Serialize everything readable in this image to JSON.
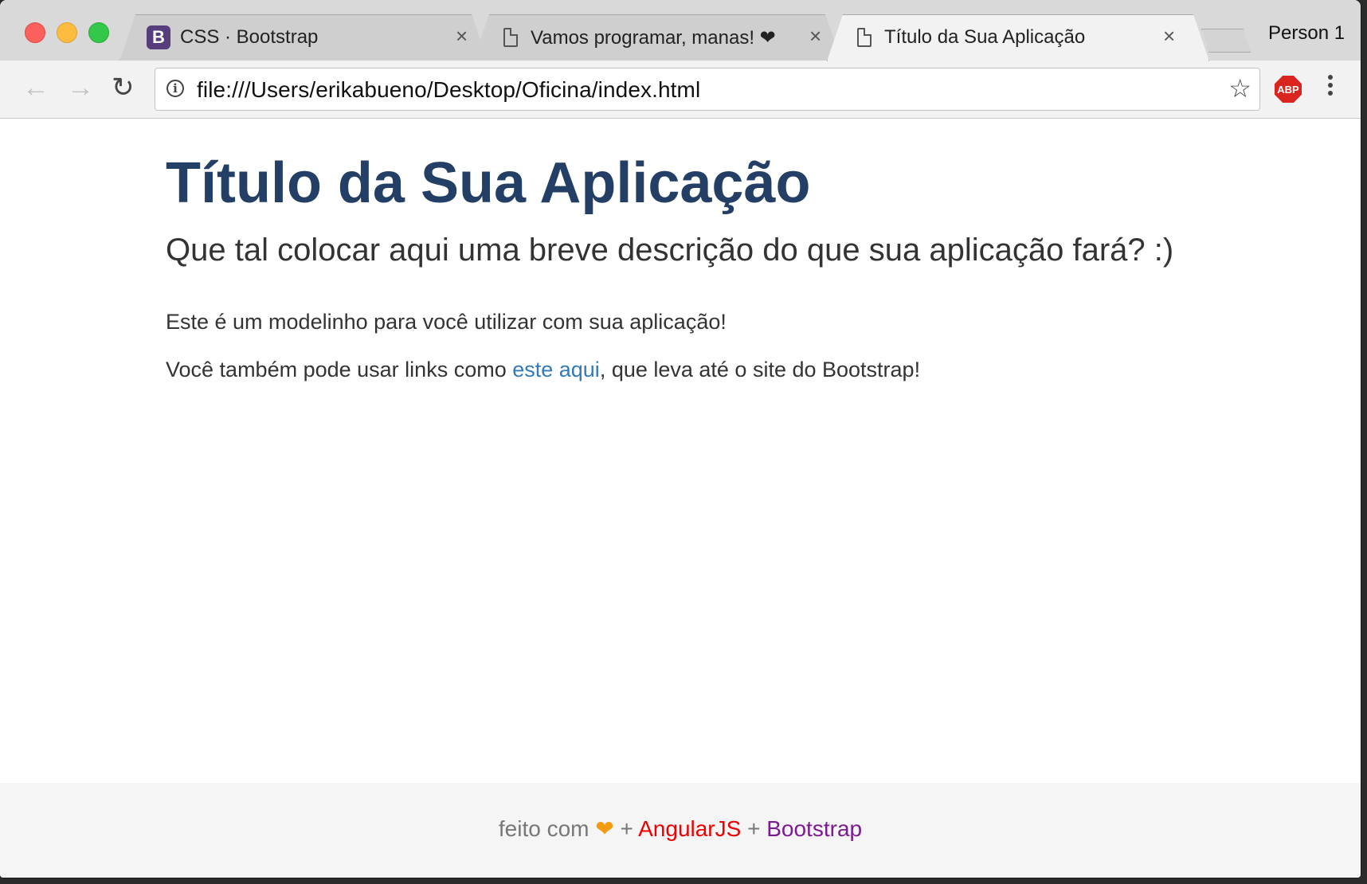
{
  "browser": {
    "tabs": [
      {
        "label": "CSS · Bootstrap",
        "favicon": "B",
        "close": "×"
      },
      {
        "label": "Vamos programar, manas! ❤",
        "close": "×"
      },
      {
        "label": "Título da Sua Aplicação",
        "close": "×",
        "active": true
      }
    ],
    "profile": "Person 1",
    "url": "file:///Users/erikabueno/Desktop/Oficina/index.html",
    "back_icon": "←",
    "forward_icon": "→",
    "reload_icon": "↻",
    "info_icon": "i",
    "star_icon": "☆",
    "abp_label": "ABP",
    "menu_icon": "⋮"
  },
  "page": {
    "title": "Título da Sua Aplicação",
    "lead": "Que tal colocar aqui uma breve descrição do que sua aplicação fará? :)",
    "paragraph1": "Este é um modelinho para você utilizar com sua aplicação!",
    "paragraph2_before": "Você também pode usar links como ",
    "paragraph2_link": "este aqui",
    "paragraph2_after": ", que leva até o site do Bootstrap!"
  },
  "footer": {
    "made_with": "feito com",
    "heart": "❤",
    "plus1": "+",
    "angular": "AngularJS",
    "plus2": "+",
    "bootstrap": "Bootstrap"
  },
  "colors": {
    "title": "#233f65",
    "link": "#337ab7",
    "angular": "#ee0000",
    "bootstrap": "#7b1b8f",
    "heart": "#f39c12"
  }
}
